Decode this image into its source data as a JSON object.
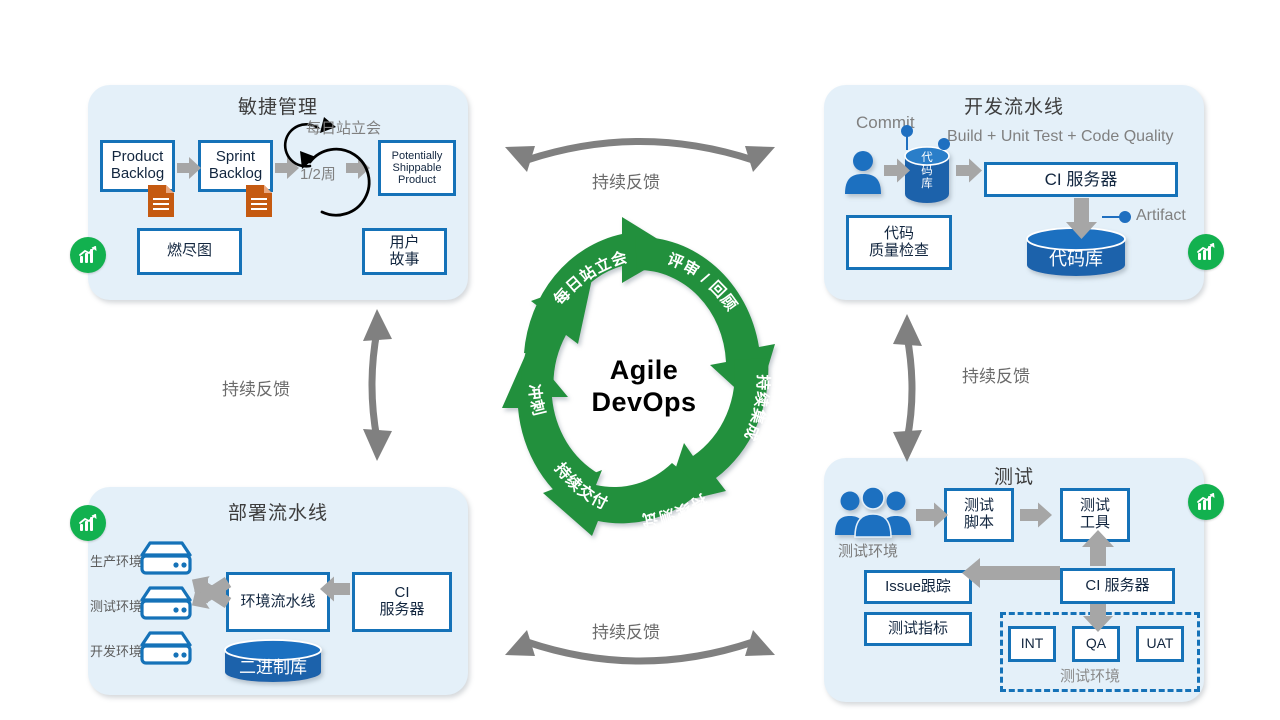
{
  "center": {
    "title_line1": "Agile",
    "title_line2": "DevOps",
    "segments": [
      {
        "id": "daily-standup",
        "label": "每日站立会"
      },
      {
        "id": "review-retrospective",
        "label": "评审 / 回顾"
      },
      {
        "id": "continuous-integration",
        "label": "持续集成"
      },
      {
        "id": "continuous-testing",
        "label": "持续测试"
      },
      {
        "id": "continuous-delivery",
        "label": "持续交付"
      },
      {
        "id": "sprint",
        "label": "冲刺"
      }
    ],
    "ring_color": "#23903c"
  },
  "feedback_arrows": {
    "top": "持续反馈",
    "bottom": "持续反馈",
    "left": "持续反馈",
    "right": "持续反馈"
  },
  "agile": {
    "title": "敏捷管理",
    "product_backlog": "Product\nBacklog",
    "product_backlog_l1": "Product",
    "product_backlog_l2": "Backlog",
    "sprint_backlog_l1": "Sprint",
    "sprint_backlog_l2": "Backlog",
    "psp_l1": "Potentially",
    "psp_l2": "Shippable",
    "psp_l3": "Product",
    "daily_standup": "每日站立会",
    "sprint_length": "1/2周",
    "burndown": "燃尽图",
    "user_story_l1": "用户",
    "user_story_l2": "故事",
    "doc_icon": "document-icon",
    "badge_icon": "growth-chart-icon"
  },
  "dev_pipeline": {
    "title": "开发流水线",
    "commit": "Commit",
    "build_label": "Build + Unit Test + Code Quality",
    "repo_small": "代码库",
    "repo_small_chars": [
      "代",
      "码",
      "库"
    ],
    "ci_server": "CI 服务器",
    "artifact": "Artifact",
    "code_repo": "代码库",
    "quality_check_l1": "代码",
    "quality_check_l2": "质量检查",
    "user_icon": "person-icon",
    "badge_icon": "growth-chart-icon"
  },
  "deploy_pipeline": {
    "title": "部署流水线",
    "env_prod": "生产环境",
    "env_test": "测试环境",
    "env_dev": "开发环境",
    "env_pipeline": "环境流水线",
    "ci_server_l1": "CI",
    "ci_server_l2": "服务器",
    "binary_repo": "二进制库",
    "server_icon": "server-icon",
    "badge_icon": "growth-chart-icon"
  },
  "testing": {
    "title": "测试",
    "people_label": "测试环境",
    "test_script_l1": "测试",
    "test_script_l2": "脚本",
    "test_tool_l1": "测试",
    "test_tool_l2": "工具",
    "issue_tracking": "Issue跟踪",
    "test_metrics": "测试指标",
    "ci_server": "CI 服务器",
    "envs": [
      "INT",
      "QA",
      "UAT"
    ],
    "env_group_label": "测试环境",
    "people_icon": "people-group-icon",
    "badge_icon": "growth-chart-icon"
  },
  "colors": {
    "panel_bg": "#e4f0f9",
    "box_border": "#1572b8",
    "arrow_gray": "#a6a6a6",
    "feedback_gray": "#808080",
    "green": "#23903c",
    "badge_green": "#12b14f",
    "doc_orange": "#c55a11",
    "cylinder_blue": "#1b62ab"
  }
}
